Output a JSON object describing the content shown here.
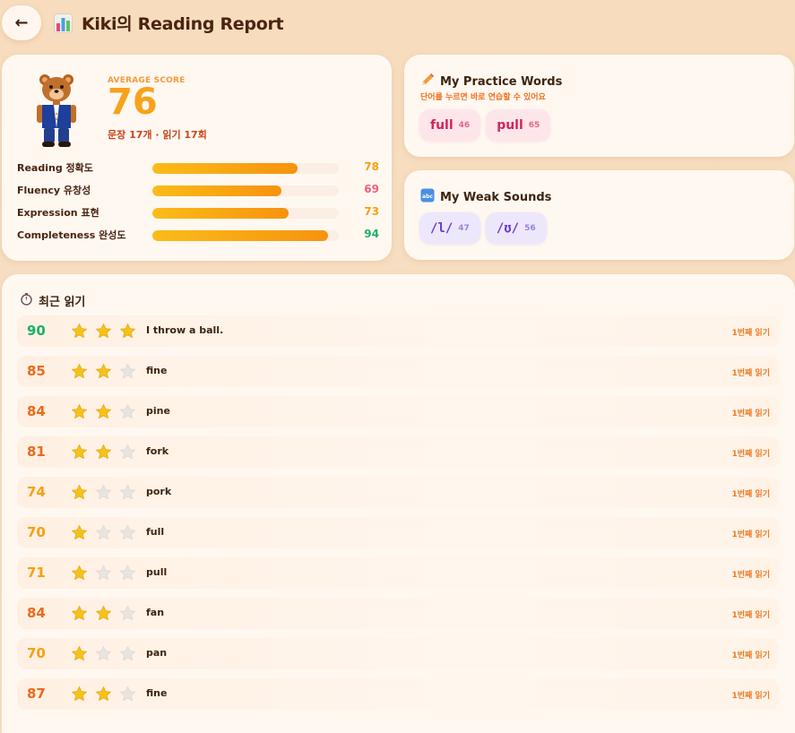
{
  "header": {
    "back_label": "←",
    "title": "Kiki의 Reading Report",
    "title_icon": "bar-chart-icon"
  },
  "score_card": {
    "avatar_icon": "bear-avatar",
    "avg_label": "AVERAGE SCORE",
    "avg_value": "76",
    "summary": "문장 17개 · 읽기 17회",
    "metrics": [
      {
        "label": "Reading 정확도",
        "value": "78",
        "level": 0.78,
        "color": "#f5a00f"
      },
      {
        "label": "Fluency 유창성",
        "value": "69",
        "level": 0.69,
        "color": "#ef5d7a"
      },
      {
        "label": "Expression 표현",
        "value": "73",
        "level": 0.73,
        "color": "#f5a00f"
      },
      {
        "label": "Completeness 완성도",
        "value": "94",
        "level": 0.94,
        "color": "#1bb068"
      }
    ]
  },
  "practice": {
    "icon": "pencil-icon",
    "title": "My Practice Words",
    "subtitle": "단어를 누르면 바로 연습할 수 있어요",
    "words": [
      {
        "word": "full",
        "count": "46"
      },
      {
        "word": "pull",
        "count": "65"
      }
    ]
  },
  "weak": {
    "icon": "abc-icon",
    "title": "My Weak Sounds",
    "sounds": [
      {
        "sound": "/l/",
        "count": "47"
      },
      {
        "sound": "/ʊ/",
        "count": "56"
      }
    ]
  },
  "recent": {
    "icon": "stopwatch-icon",
    "title": "최근 읽기",
    "rows": [
      {
        "score": "90",
        "stars": 3,
        "sentence": "I throw a ball.",
        "count": "1번째 읽기",
        "score_color": "#1bb068"
      },
      {
        "score": "85",
        "stars": 2,
        "sentence": "fine",
        "count": "1번째 읽기",
        "score_color": "#ec6a1a"
      },
      {
        "score": "84",
        "stars": 2,
        "sentence": "pine",
        "count": "1번째 읽기",
        "score_color": "#ec6a1a"
      },
      {
        "score": "81",
        "stars": 2,
        "sentence": "fork",
        "count": "1번째 읽기",
        "score_color": "#ec6a1a"
      },
      {
        "score": "74",
        "stars": 1,
        "sentence": "pork",
        "count": "1번째 읽기",
        "score_color": "#f5a00f"
      },
      {
        "score": "70",
        "stars": 1,
        "sentence": "full",
        "count": "1번째 읽기",
        "score_color": "#f5a00f"
      },
      {
        "score": "71",
        "stars": 1,
        "sentence": "pull",
        "count": "1번째 읽기",
        "score_color": "#f5a00f"
      },
      {
        "score": "84",
        "stars": 2,
        "sentence": "fan",
        "count": "1번째 읽기",
        "score_color": "#ec6a1a"
      },
      {
        "score": "70",
        "stars": 1,
        "sentence": "pan",
        "count": "1번째 읽기",
        "score_color": "#f5a00f"
      },
      {
        "score": "87",
        "stars": 2,
        "sentence": "fine",
        "count": "1번째 읽기",
        "score_color": "#ec6a1a"
      }
    ]
  },
  "colors": {
    "background": "#f7dcbd",
    "card": "#fff8f1",
    "accent_orange": "#f7a21b",
    "star_filled": "#f5c21b",
    "star_empty": "#e8e4e0"
  }
}
